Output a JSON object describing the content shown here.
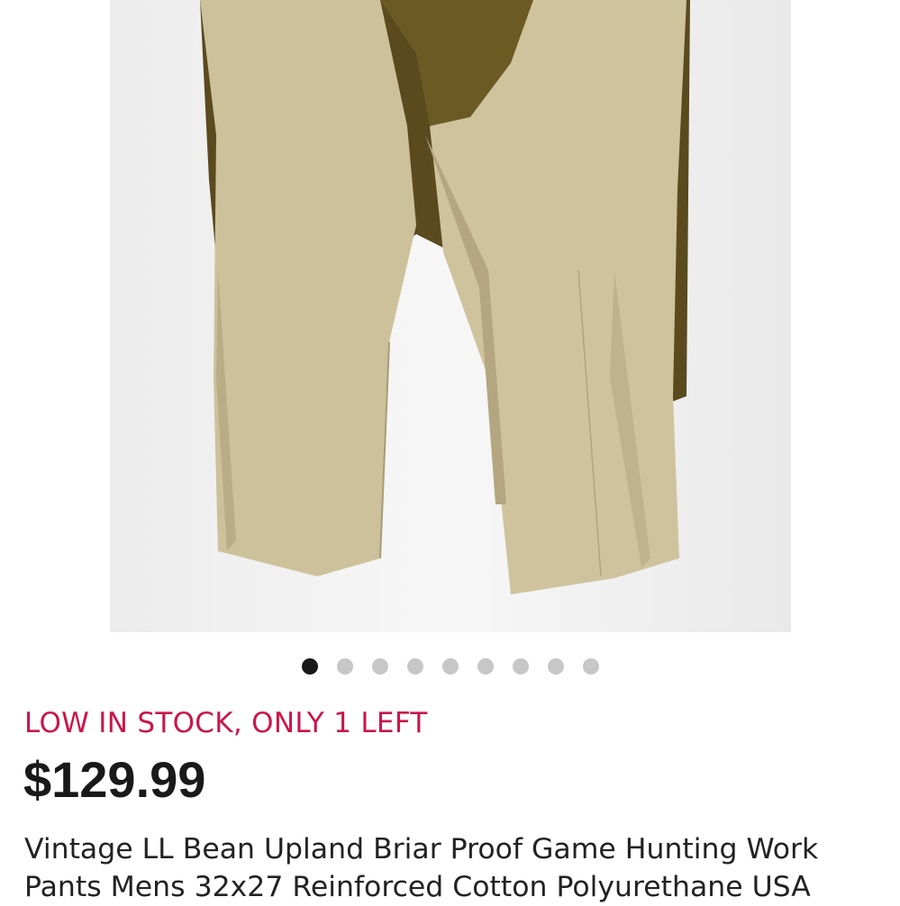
{
  "listing": {
    "stock_notice": "LOW IN STOCK, ONLY 1 LEFT",
    "price": "$129.99",
    "title": "Vintage LL Bean Upland Briar Proof Game Hunting Work Pants Mens 32x27 Reinforced Cotton Polyurethane USA"
  },
  "gallery": {
    "image_count": 9,
    "active_index": 0
  },
  "colors": {
    "stock_notice": "#c8174a",
    "price": "#191919",
    "dot_active": "#191919",
    "dot_inactive": "#c7c7c7"
  }
}
